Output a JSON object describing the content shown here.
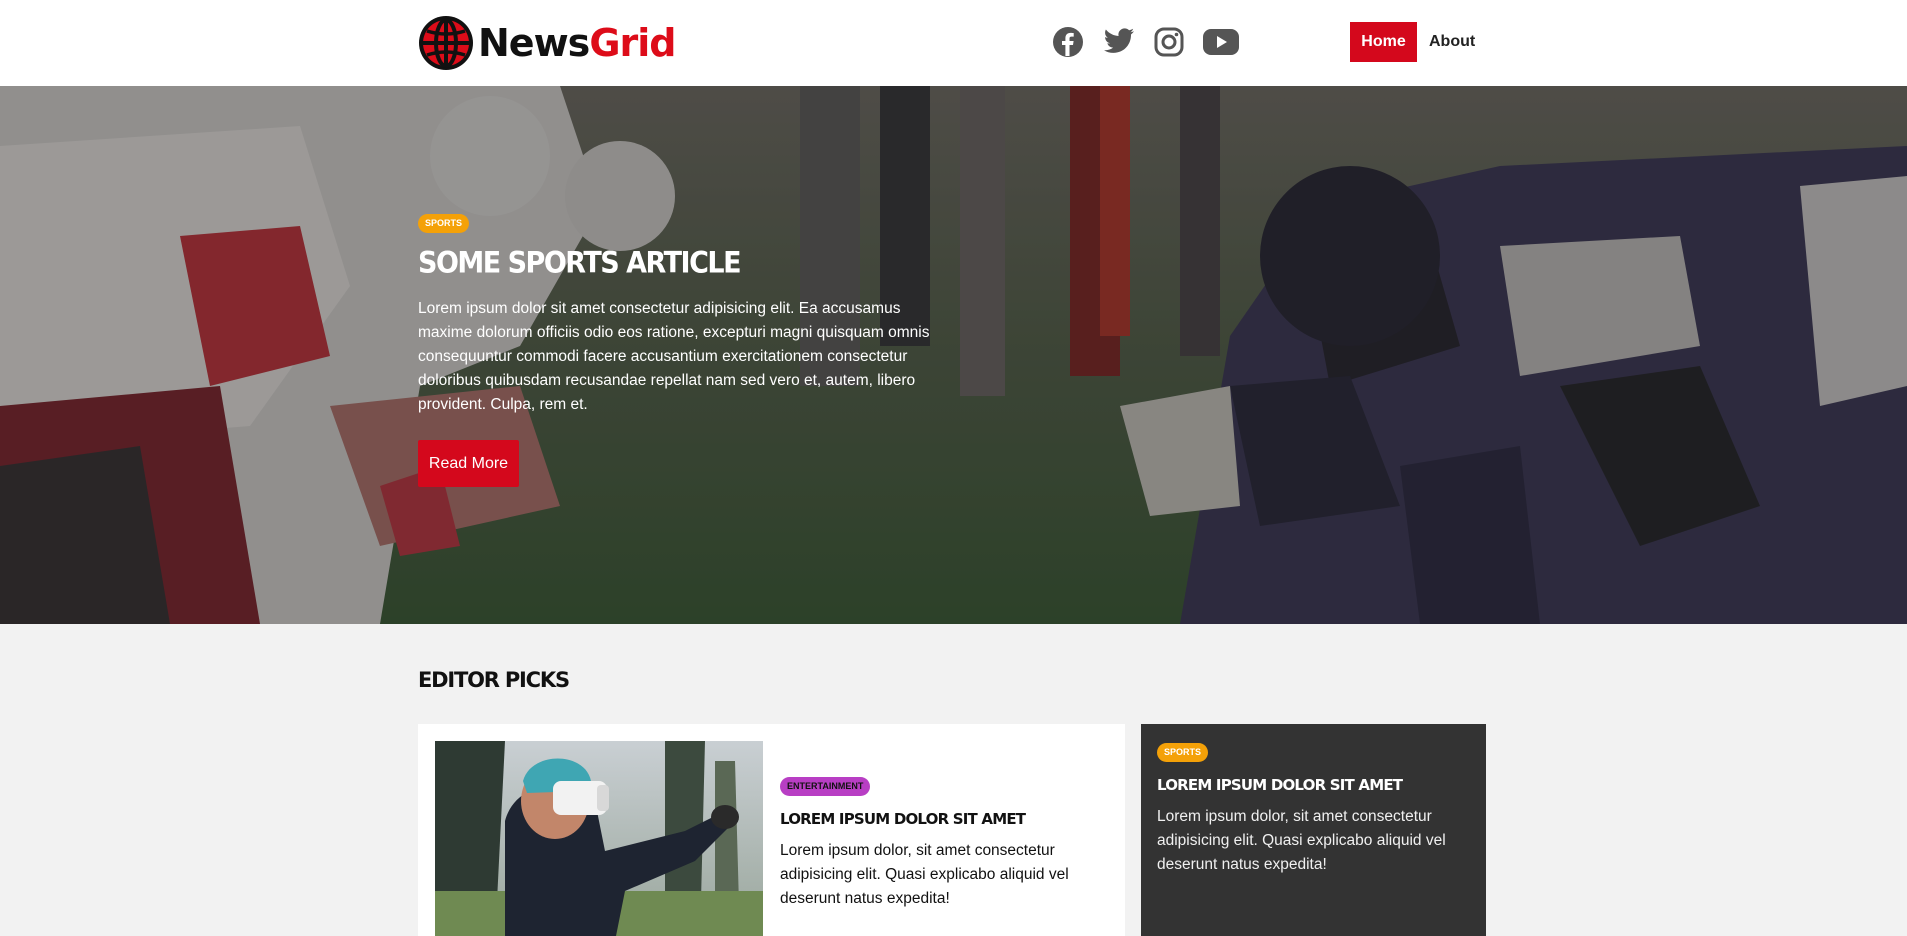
{
  "brand": {
    "name_part1": "News",
    "name_part2": "Grid",
    "accent_color": "#dd0c19",
    "logo_icon": "globe-icon"
  },
  "social": [
    "facebook-icon",
    "twitter-icon",
    "instagram-icon",
    "youtube-icon"
  ],
  "nav": {
    "home": "Home",
    "about": "About"
  },
  "hero": {
    "category": "Sports",
    "title": "Some Sports Article",
    "text": "Lorem ipsum dolor sit amet consectetur adipisicing elit. Ea accusamus maxime dolorum officiis odio eos ratione, excepturi magni quisquam omnis consequuntur commodi facere accusantium exercitationem consectetur doloribus quibusdam recusandae repellat nam sed vero et, autem, libero provident. Culpa, rem et.",
    "button": "Read More"
  },
  "editor_picks": {
    "title": "Editor Picks",
    "cards": [
      {
        "category": "Entertainment",
        "title": "Lorem ipsum dolor sit amet",
        "text": "Lorem ipsum dolor, sit amet consectetur adipisicing elit. Quasi explicabo aliquid vel deserunt natus expedita!"
      },
      {
        "category": "Sports",
        "title": "Lorem ipsum dolor sit amet",
        "text": "Lorem ipsum dolor, sit amet consectetur adipisicing elit. Quasi explicabo aliquid vel deserunt natus expedita!"
      }
    ]
  }
}
